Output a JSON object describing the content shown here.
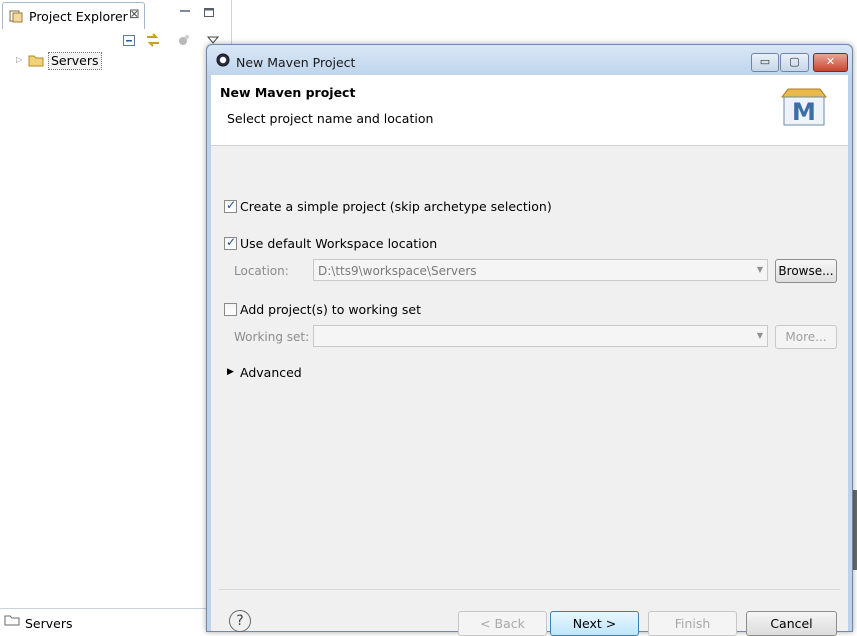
{
  "explorer": {
    "tab_label": "Project Explorer",
    "tab_close_glyph": "⊠",
    "tab_icon": "project-explorer-icon",
    "toolbar_icons": [
      "collapse-all-icon",
      "link-with-editor-icon",
      "focus-icon",
      "view-menu-icon"
    ],
    "tree_items": [
      {
        "label": "Servers",
        "icon": "folder-icon"
      }
    ]
  },
  "bottom_view": {
    "label": "Servers",
    "icon": "folder-icon"
  },
  "dialog": {
    "title": "New Maven Project",
    "window_buttons": {
      "minimize": "▭",
      "maximize": "▢",
      "close": "✕"
    },
    "banner": {
      "title": "New Maven project",
      "subtitle": "Select project name and location",
      "logo_text": "M"
    },
    "simple_project": {
      "label": "Create a simple project (skip archetype selection)",
      "checked": true
    },
    "default_location": {
      "label": "Use default Workspace location",
      "checked": true
    },
    "location": {
      "label": "Location:",
      "value": "D:\\tts9\\workspace\\Servers",
      "enabled": false
    },
    "browse_label": "Browse...",
    "working_set_check": {
      "label": "Add project(s) to working set",
      "checked": false
    },
    "working_set": {
      "label": "Working set:",
      "value": "",
      "enabled": false
    },
    "more_label": "More...",
    "advanced_label": "Advanced",
    "help_glyph": "?",
    "buttons": {
      "back": "< Back",
      "next": "Next >",
      "finish": "Finish",
      "cancel": "Cancel"
    },
    "colors": {
      "titlebar": "#bfd5ec",
      "client": "#f0f0f0",
      "close_button": "#c8452f",
      "default_button": "#bee6fd"
    }
  }
}
